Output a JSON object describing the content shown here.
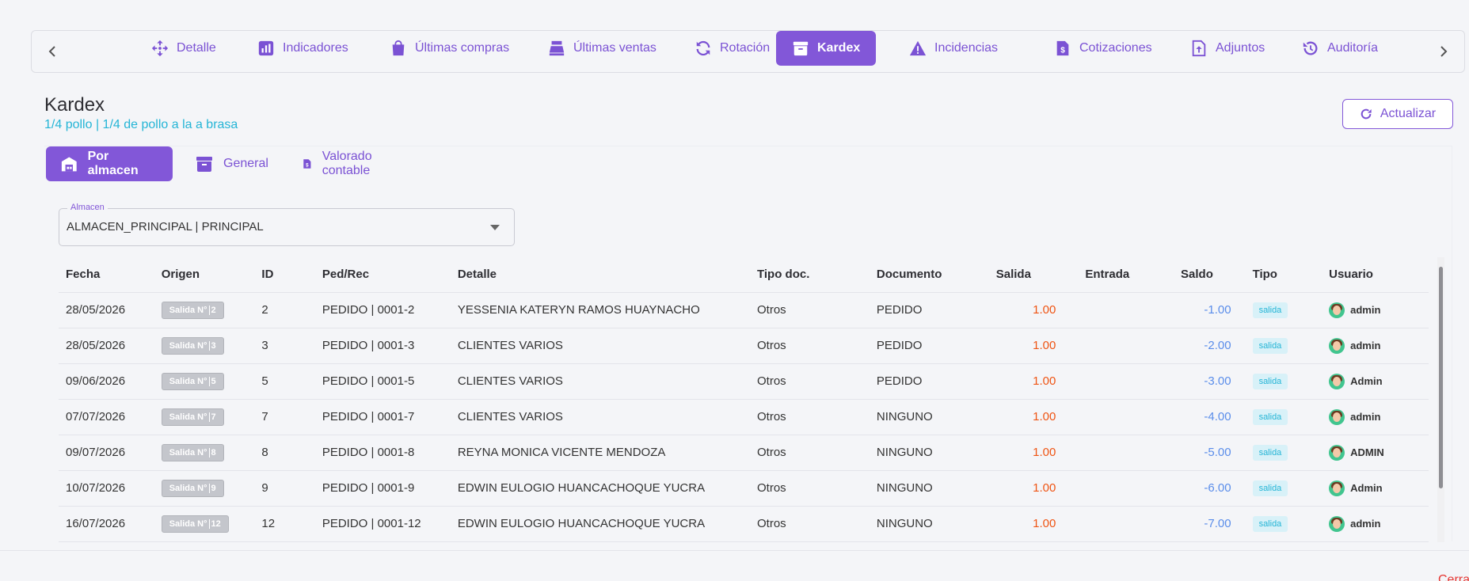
{
  "nav": {
    "tabs": [
      {
        "label": "Detalle",
        "icon": "move-icon",
        "active": false
      },
      {
        "label": "Indicadores",
        "icon": "chart-icon",
        "active": false
      },
      {
        "label": "Últimas compras",
        "icon": "shopping-bag-icon",
        "active": false
      },
      {
        "label": "Últimas ventas",
        "icon": "cash-register-icon",
        "active": false
      },
      {
        "label": "Rotación",
        "icon": "sync-icon",
        "active": false
      },
      {
        "label": "Kardex",
        "icon": "archive-icon",
        "active": true
      },
      {
        "label": "Incidencias",
        "icon": "warning-icon",
        "active": false
      },
      {
        "label": "Cotizaciones",
        "icon": "invoice-dollar-icon",
        "active": false
      },
      {
        "label": "Adjuntos",
        "icon": "file-upload-icon",
        "active": false
      },
      {
        "label": "Auditoría",
        "icon": "history-icon",
        "active": false
      }
    ]
  },
  "header": {
    "title": "Kardex",
    "subtitle": "1/4 pollo | 1/4 de pollo a la a brasa",
    "refresh_label": "Actualizar"
  },
  "subtabs": [
    {
      "label": "Por almacen",
      "icon": "warehouse-icon",
      "active": true
    },
    {
      "label": "General",
      "icon": "archive-icon",
      "active": false
    },
    {
      "label": "Valorado contable",
      "icon": "invoice-dollar-icon",
      "active": false
    }
  ],
  "warehouse_select": {
    "label": "Almacen",
    "value": "ALMACEN_PRINCIPAL | PRINCIPAL"
  },
  "table": {
    "columns": [
      "Fecha",
      "Origen",
      "ID",
      "Ped/Rec",
      "Detalle",
      "Tipo doc.",
      "Documento",
      "Salida",
      "Entrada",
      "Saldo",
      "Tipo",
      "Usuario"
    ],
    "rows": [
      {
        "fecha": "28/05/2026",
        "origen": "Salida N°",
        "origen_num": "2",
        "id": "2",
        "ped": "PEDIDO | 0001-2",
        "detalle": "YESSENIA KATERYN RAMOS HUAYNACHO",
        "tipo_doc": "Otros",
        "documento": "PEDIDO",
        "salida": "1.00",
        "entrada": "",
        "saldo": "-1.00",
        "tipo": "salida",
        "usuario": "admin"
      },
      {
        "fecha": "28/05/2026",
        "origen": "Salida N°",
        "origen_num": "3",
        "id": "3",
        "ped": "PEDIDO | 0001-3",
        "detalle": "CLIENTES VARIOS",
        "tipo_doc": "Otros",
        "documento": "PEDIDO",
        "salida": "1.00",
        "entrada": "",
        "saldo": "-2.00",
        "tipo": "salida",
        "usuario": "admin"
      },
      {
        "fecha": "09/06/2026",
        "origen": "Salida N°",
        "origen_num": "5",
        "id": "5",
        "ped": "PEDIDO | 0001-5",
        "detalle": "CLIENTES VARIOS",
        "tipo_doc": "Otros",
        "documento": "PEDIDO",
        "salida": "1.00",
        "entrada": "",
        "saldo": "-3.00",
        "tipo": "salida",
        "usuario": "Admin"
      },
      {
        "fecha": "07/07/2026",
        "origen": "Salida N°",
        "origen_num": "7",
        "id": "7",
        "ped": "PEDIDO | 0001-7",
        "detalle": "CLIENTES VARIOS",
        "tipo_doc": "Otros",
        "documento": "NINGUNO",
        "salida": "1.00",
        "entrada": "",
        "saldo": "-4.00",
        "tipo": "salida",
        "usuario": "admin"
      },
      {
        "fecha": "09/07/2026",
        "origen": "Salida N°",
        "origen_num": "8",
        "id": "8",
        "ped": "PEDIDO | 0001-8",
        "detalle": "REYNA MONICA VICENTE MENDOZA",
        "tipo_doc": "Otros",
        "documento": "NINGUNO",
        "salida": "1.00",
        "entrada": "",
        "saldo": "-5.00",
        "tipo": "salida",
        "usuario": "ADMIN"
      },
      {
        "fecha": "10/07/2026",
        "origen": "Salida N°",
        "origen_num": "9",
        "id": "9",
        "ped": "PEDIDO | 0001-9",
        "detalle": "EDWIN EULOGIO HUANCACHOQUE YUCRA",
        "tipo_doc": "Otros",
        "documento": "NINGUNO",
        "salida": "1.00",
        "entrada": "",
        "saldo": "-6.00",
        "tipo": "salida",
        "usuario": "Admin"
      },
      {
        "fecha": "16/07/2026",
        "origen": "Salida N°",
        "origen_num": "12",
        "id": "12",
        "ped": "PEDIDO | 0001-12",
        "detalle": "EDWIN EULOGIO HUANCACHOQUE YUCRA",
        "tipo_doc": "Otros",
        "documento": "NINGUNO",
        "salida": "1.00",
        "entrada": "",
        "saldo": "-7.00",
        "tipo": "salida",
        "usuario": "admin"
      }
    ]
  },
  "footer": {
    "close_label": "Cerrar"
  },
  "colors": {
    "accent": "#8257d8",
    "salida": "#ef5413",
    "saldo": "#5a8dea",
    "subtitle": "#25b5d6"
  }
}
